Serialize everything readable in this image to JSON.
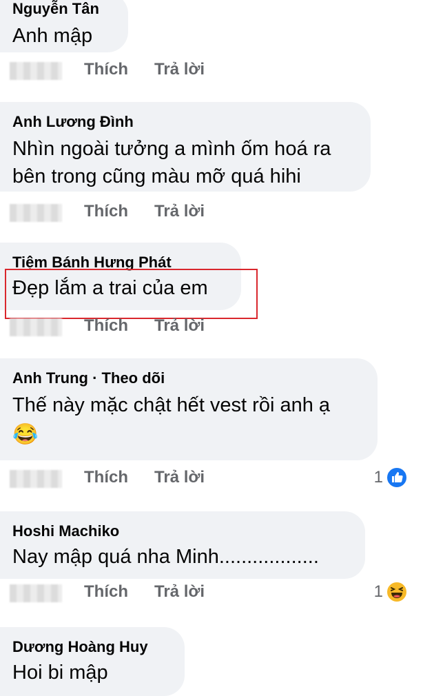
{
  "comments": [
    {
      "name": "Nguyễn Tân",
      "text": "Anh mập",
      "like": "Thích",
      "reply": "Trả lời"
    },
    {
      "name": "Anh Lương Đình",
      "text": "Nhìn ngoài tưởng a mình ốm hoá ra bên trong cũng màu mỡ quá hihi",
      "like": "Thích",
      "reply": "Trả lời"
    },
    {
      "name": "Tiệm Bánh Hưng Phát",
      "text": "Đẹp lắm a trai của em",
      "like": "Thích",
      "reply": "Trả lời"
    },
    {
      "name": "Anh Trung · Theo dõi",
      "text": "Thế này mặc chật hết vest rồi anh ạ",
      "emoji": "😂",
      "like": "Thích",
      "reply": "Trả lời",
      "reaction_count": "1",
      "reaction_icon": "like-icon"
    },
    {
      "name": "Hoshi Machiko",
      "text": "Nay mập quá nha Minh..................",
      "like": "Thích",
      "reply": "Trả lời",
      "reaction_count": "1",
      "reaction_icon": "haha-icon"
    },
    {
      "name": "Dương Hoàng Huy",
      "text": "Hoi bi mập"
    }
  ],
  "colors": {
    "bubble": "#f0f2f5",
    "secondary_text": "#65676b",
    "highlight": "#d9262c",
    "like_blue": "#1877f2"
  }
}
